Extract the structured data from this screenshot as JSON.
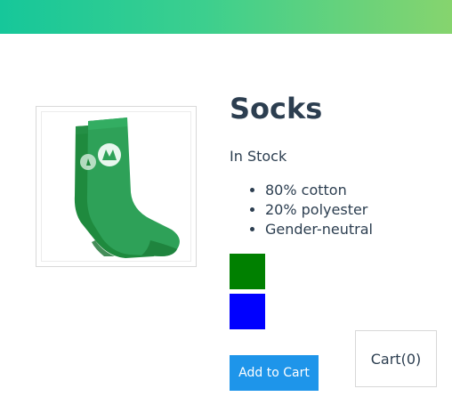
{
  "nav": {
    "gradient": [
      "#16c79a",
      "#3ccf8e",
      "#86d46e"
    ]
  },
  "product": {
    "title": "Socks",
    "stock": "In Stock",
    "details": [
      "80% cotton",
      "20% polyester",
      "Gender-neutral"
    ],
    "image_icon": "green-socks-image",
    "variants": [
      {
        "color": "#008000",
        "icon": "green-swatch"
      },
      {
        "color": "#0000ff",
        "icon": "blue-swatch"
      }
    ]
  },
  "cart": {
    "label": "Cart(0)"
  },
  "actions": {
    "add_to_cart": "Add to Cart"
  },
  "colors": {
    "button": "#1e95ea",
    "text": "#2c3e50"
  }
}
